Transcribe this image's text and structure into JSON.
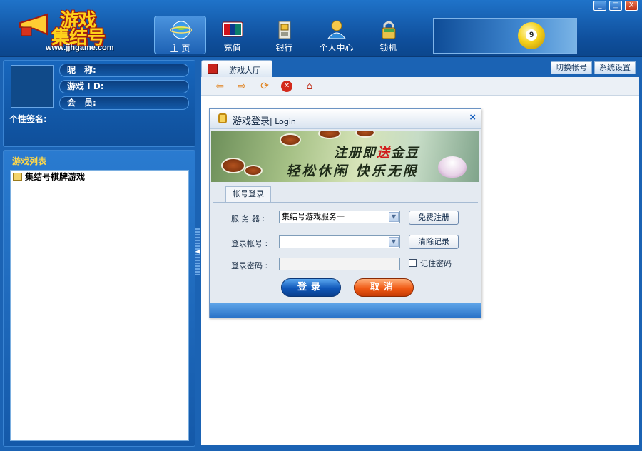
{
  "app": {
    "logo_line1": "游戏",
    "logo_line2": "集结号",
    "logo_url": "www.jjhgame.com"
  },
  "nav": [
    {
      "label": "主 页",
      "icon": "globe-icon",
      "active": true
    },
    {
      "label": "充值",
      "icon": "unionpay-card-icon",
      "active": false
    },
    {
      "label": "银行",
      "icon": "bank-building-icon",
      "active": false
    },
    {
      "label": "个人中心",
      "icon": "user-center-icon",
      "active": false
    },
    {
      "label": "锁机",
      "icon": "padlock-icon",
      "active": false
    }
  ],
  "banner_ball_number": "9",
  "window_controls": [
    "_",
    "□",
    "X"
  ],
  "profile": {
    "nickname_label": "昵　称:",
    "id_label": "游戏 I D:",
    "member_label": "会　员:",
    "signature_label": "个性签名:"
  },
  "games": {
    "title": "游戏列表",
    "items": [
      {
        "label": "集结号棋牌游戏"
      }
    ]
  },
  "tabs": {
    "active_label": "游戏大厅",
    "switch_account": "切换帐号",
    "system_settings": "系统设置"
  },
  "toolbar": {
    "back": "⇦",
    "forward": "⇨",
    "refresh": "⟳",
    "stop": "✕",
    "home": "⌂"
  },
  "login_dialog": {
    "title": "游戏登录",
    "title_en": "| Login",
    "close": "×",
    "banner_line1_a": "注册即",
    "banner_line1_highlight": "送",
    "banner_line1_b": "金豆",
    "banner_line2": "轻松休闲  快乐无限",
    "tab_label": "帐号登录",
    "server_label": "服 务 器 :",
    "server_value": "集结号游戏服务一",
    "account_label": "登录帐号 :",
    "account_value": "",
    "password_label": "登录密码 :",
    "free_register": "免费注册",
    "clear_records": "清除记录",
    "remember_password": "记住密码",
    "remember_checked": false,
    "login_button": "登录",
    "cancel_button": "取消"
  },
  "colors": {
    "frame_blue": "#1b63b4",
    "accent_yellow": "#ffd21a",
    "login_blue": "#0f56b8",
    "cancel_orange": "#f05a14"
  }
}
